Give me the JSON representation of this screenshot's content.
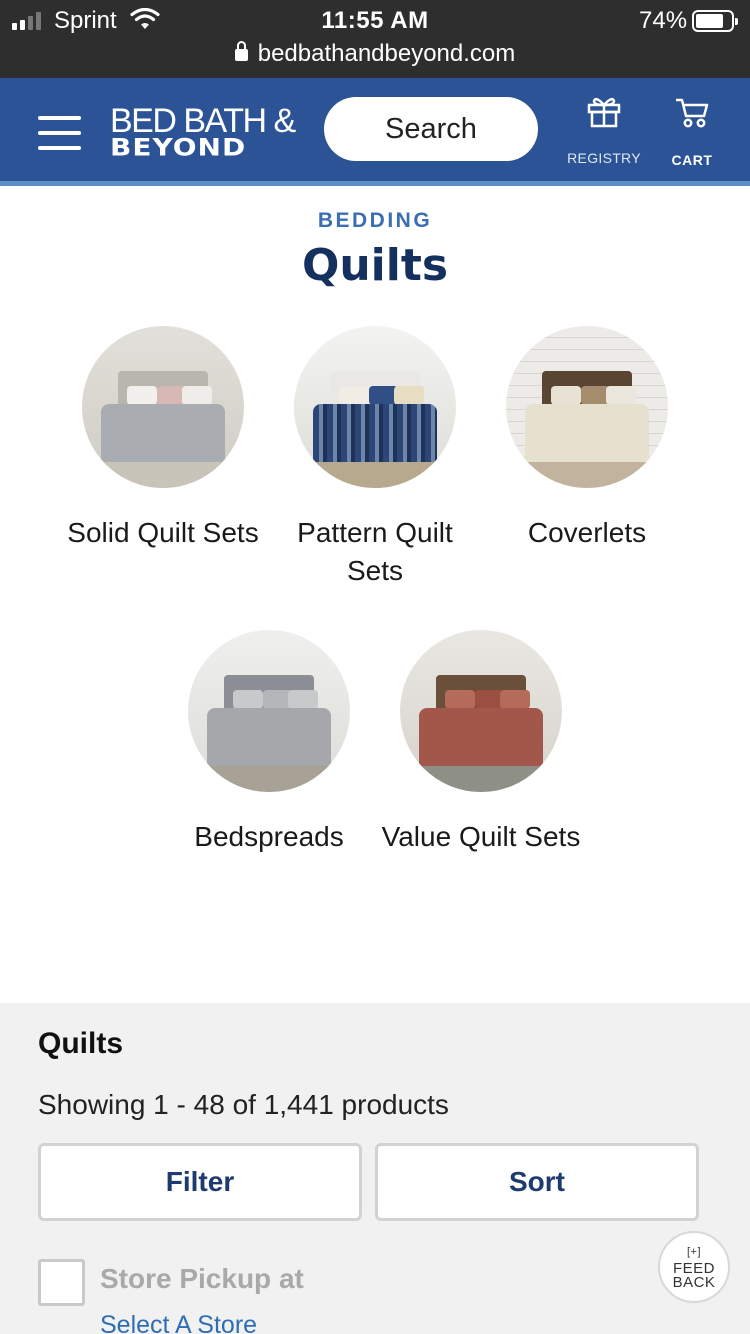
{
  "status_bar": {
    "carrier": "Sprint",
    "time": "11:55 AM",
    "battery": "74%",
    "battery_level": 0.74,
    "url": "bedbathandbeyond.com"
  },
  "header": {
    "logo_line1": "BED BATH &",
    "logo_line2": "BEYOND",
    "search_label": "Search",
    "registry_label": "REGISTRY",
    "cart_label": "CART",
    "colors": {
      "bar": "#2b5395",
      "underline": "#5b8fc6"
    }
  },
  "category": {
    "eyebrow": "BEDDING",
    "title": "Quilts"
  },
  "tiles": [
    {
      "label": "Solid Quilt Sets",
      "image": "solid-quilt-bed-photo"
    },
    {
      "label": "Pattern Quilt Sets",
      "image": "pattern-quilt-bed-photo"
    },
    {
      "label": "Coverlets",
      "image": "coverlet-bed-photo"
    },
    {
      "label": "Bedspreads",
      "image": "bedspread-bed-photo"
    },
    {
      "label": "Value Quilt Sets",
      "image": "value-quilt-bed-photo"
    }
  ],
  "results": {
    "title": "Quilts",
    "count_text": "Showing 1 - 48 of 1,441 products",
    "filter_label": "Filter",
    "sort_label": "Sort",
    "pickup_label": "Store Pickup at",
    "select_store_label": "Select A Store",
    "feedback_plus": "[+]",
    "feedback_line1": "FEED",
    "feedback_line2": "BACK"
  }
}
